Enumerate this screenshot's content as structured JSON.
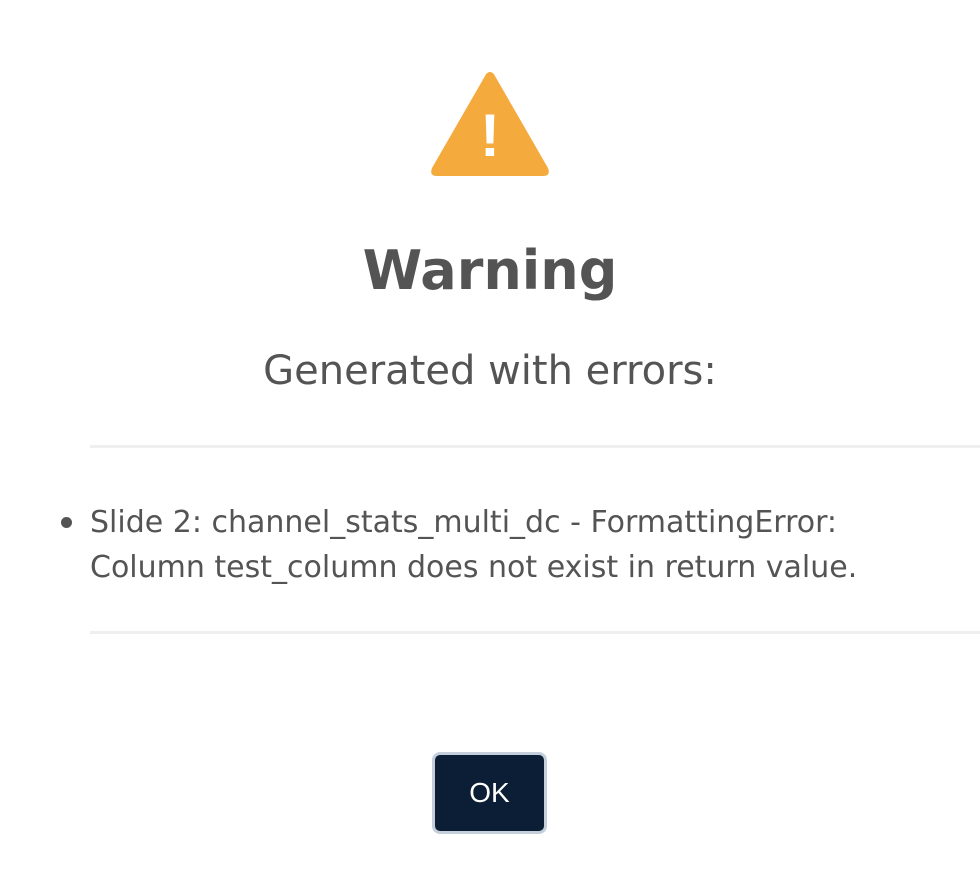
{
  "dialog": {
    "icon": "warning-triangle-icon",
    "icon_glyph": "!",
    "icon_color": "#f4aa3d",
    "title": "Warning",
    "subtitle": "Generated with errors:",
    "errors": [
      "Slide 2: channel_stats_multi_dc - FormattingError: Column test_column does not exist in return value."
    ],
    "ok_label": "OK",
    "button_color": "#0c1e35"
  }
}
